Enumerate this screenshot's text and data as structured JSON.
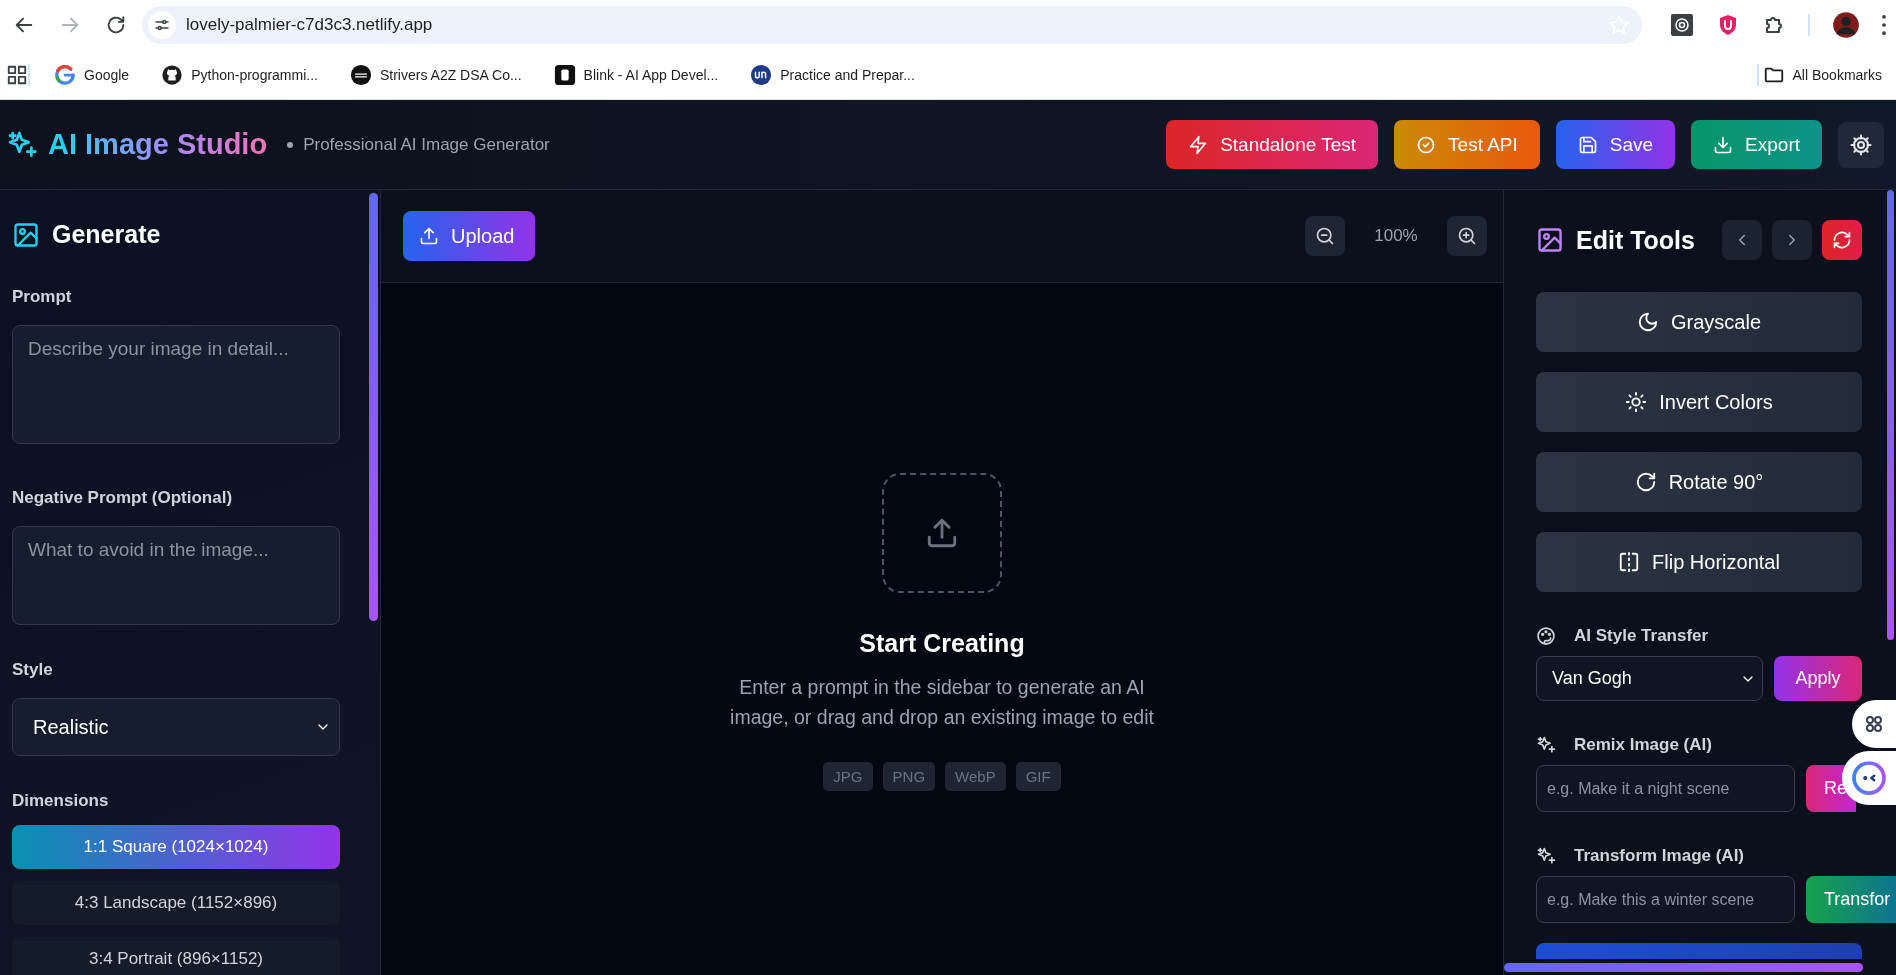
{
  "browser": {
    "back": {
      "disabled": false
    },
    "forward": {
      "disabled": true
    },
    "url": "lovely-palmier-c7d3c3.netlify.app",
    "bookmarks": [
      {
        "label": "Google",
        "kind": "google"
      },
      {
        "label": "Python-programmi...",
        "kind": "github"
      },
      {
        "label": "Strivers A2Z DSA Co...",
        "kind": "tuf"
      },
      {
        "label": "Blink - AI App Devel...",
        "kind": "blink"
      },
      {
        "label": "Practice and Prepar...",
        "kind": "un"
      }
    ],
    "all_bookmarks": "All Bookmarks"
  },
  "header": {
    "title": "AI Image Studio",
    "subtitle": "Professional AI Image Generator",
    "actions": [
      {
        "label": "Standalone Test",
        "kind": "standalone"
      },
      {
        "label": "Test API",
        "kind": "test"
      },
      {
        "label": "Save",
        "kind": "save"
      },
      {
        "label": "Export",
        "kind": "export"
      }
    ]
  },
  "sidebar": {
    "title": "Generate",
    "fields": [
      {
        "label": "Prompt",
        "placeholder": "Describe your image in detail..."
      },
      {
        "label": "Negative Prompt (Optional)",
        "placeholder": "What to avoid in the image..."
      }
    ],
    "style": {
      "label": "Style",
      "value": "Realistic"
    },
    "dimensions": {
      "label": "Dimensions",
      "options": [
        {
          "label": "1:1 Square (1024×1024)",
          "selected": true
        },
        {
          "label": "4:3 Landscape (1152×896)",
          "selected": false
        },
        {
          "label": "3:4 Portrait (896×1152)",
          "selected": false
        }
      ]
    }
  },
  "canvas": {
    "upload": "Upload",
    "zoom": "100%",
    "empty": {
      "title": "Start Creating",
      "text": "Enter a prompt in the sidebar to generate an AI image, or drag and drop an existing image to edit",
      "formats": [
        "JPG",
        "PNG",
        "WebP",
        "GIF"
      ]
    }
  },
  "edit_tools": {
    "title": "Edit Tools",
    "tools": [
      {
        "label": "Grayscale",
        "kind": "grayscale"
      },
      {
        "label": "Invert Colors",
        "kind": "invert"
      },
      {
        "label": "Rotate 90°",
        "kind": "rotate"
      },
      {
        "label": "Flip Horizontal",
        "kind": "flip"
      }
    ],
    "style_transfer": {
      "label": "AI Style Transfer",
      "value": "Van Gogh",
      "button": "Apply"
    },
    "ai_prompts": [
      {
        "label": "Remix Image (AI)",
        "placeholder": "e.g. Make it a night scene",
        "button": "Re",
        "kind": "remix"
      },
      {
        "label": "Transform Image (AI)",
        "placeholder": "e.g. Make this a winter scene",
        "button": "Transfor",
        "kind": "transform"
      }
    ]
  }
}
